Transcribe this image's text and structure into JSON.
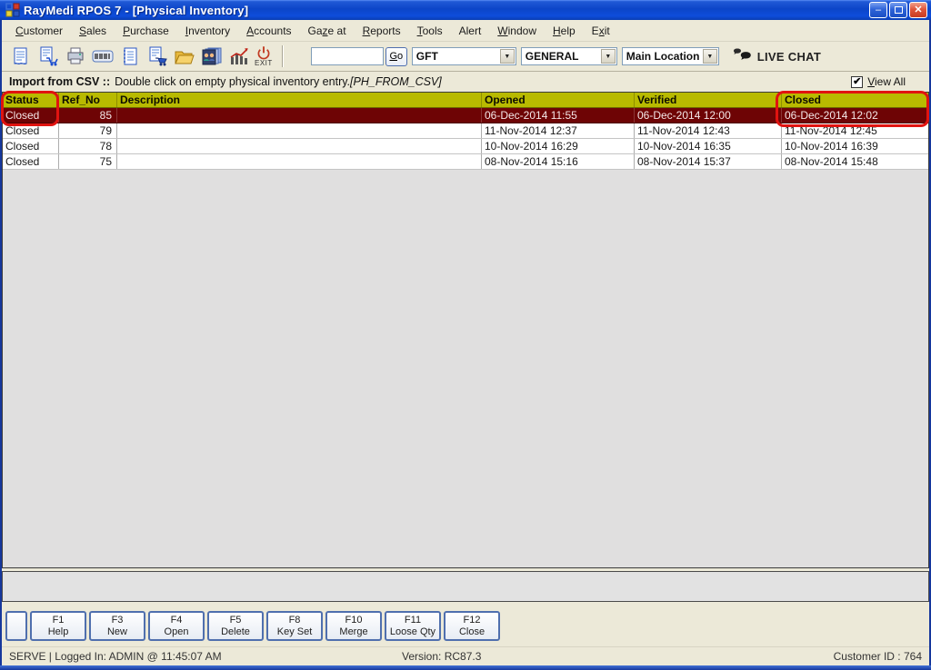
{
  "window": {
    "title": "RayMedi RPOS 7 - [Physical Inventory]",
    "controls": {
      "minimize": "minimize",
      "restore": "restore",
      "close": "close"
    }
  },
  "menu_bar": {
    "items": [
      {
        "label": "Customer",
        "underline": "C"
      },
      {
        "label": "Sales",
        "underline": "S"
      },
      {
        "label": "Purchase",
        "underline": "P"
      },
      {
        "label": "Inventory",
        "underline": "I"
      },
      {
        "label": "Accounts",
        "underline": "A"
      },
      {
        "label": "Gaze at",
        "underline": "z"
      },
      {
        "label": "Reports",
        "underline": "R"
      },
      {
        "label": "Tools",
        "underline": "T"
      },
      {
        "label": "Alert",
        "underline": ""
      },
      {
        "label": "Window",
        "underline": "W"
      },
      {
        "label": "Help",
        "underline": "H"
      },
      {
        "label": "Exit",
        "underline": "x"
      }
    ]
  },
  "toolbar": {
    "icons": [
      "invoice-icon",
      "sales-cart-icon",
      "printer-icon",
      "barcode-icon",
      "ledger-icon",
      "purchase-cart-icon",
      "open-folder-icon",
      "users-icon",
      "sales-chart-icon",
      "exit-icon"
    ],
    "exit_label": "EXIT",
    "search_value": "",
    "go_label": "Go",
    "dropdowns": [
      {
        "name": "company",
        "value": "GFT"
      },
      {
        "name": "category",
        "value": "GENERAL"
      },
      {
        "name": "location",
        "value": "Main Location"
      }
    ],
    "live_chat_label": "LIVE CHAT"
  },
  "info_bar": {
    "title": "Import from CSV ::",
    "message": "Double click on empty physical inventory entry.",
    "code": "[PH_FROM_CSV]",
    "view_all_label": "View All",
    "view_all_underline": "V",
    "view_all_checked": true
  },
  "table": {
    "columns": [
      "Status",
      "Ref_No",
      "Description",
      "Opened",
      "Verified",
      "Closed"
    ],
    "rows": [
      {
        "status": "Closed",
        "ref_no": "85",
        "description": "",
        "opened": "06-Dec-2014 11:55",
        "verified": "06-Dec-2014 12:00",
        "closed": "06-Dec-2014 12:02",
        "selected": true
      },
      {
        "status": "Closed",
        "ref_no": "79",
        "description": "",
        "opened": "11-Nov-2014 12:37",
        "verified": "11-Nov-2014 12:43",
        "closed": "11-Nov-2014 12:45",
        "selected": false
      },
      {
        "status": "Closed",
        "ref_no": "78",
        "description": "",
        "opened": "10-Nov-2014 16:29",
        "verified": "10-Nov-2014 16:35",
        "closed": "10-Nov-2014 16:39",
        "selected": false
      },
      {
        "status": "Closed",
        "ref_no": "75",
        "description": "",
        "opened": "08-Nov-2014 15:16",
        "verified": "08-Nov-2014 15:37",
        "closed": "08-Nov-2014 15:48",
        "selected": false
      }
    ]
  },
  "function_keys": [
    {
      "key": "",
      "label": ""
    },
    {
      "key": "F1",
      "label": "Help"
    },
    {
      "key": "F3",
      "label": "New"
    },
    {
      "key": "F4",
      "label": "Open"
    },
    {
      "key": "F5",
      "label": "Delete"
    },
    {
      "key": "F8",
      "label": "Key Set"
    },
    {
      "key": "F10",
      "label": "Merge"
    },
    {
      "key": "F11",
      "label": "Loose Qty"
    },
    {
      "key": "F12",
      "label": "Close"
    }
  ],
  "status_bar": {
    "left": "SERVE |  Logged In: ADMIN  @ 11:45:07 AM",
    "version": "Version: RC87.3",
    "customer": "Customer ID : 764"
  },
  "annotations": [
    "status-column-highlight",
    "closed-column-highlight"
  ],
  "colors": {
    "titlebar_blue": "#0c45c8",
    "chrome_beige": "#ece9d8",
    "table_header_bg": "#b8ba00",
    "selected_row_bg": "#6e0405",
    "annotation_red": "#e11310"
  }
}
